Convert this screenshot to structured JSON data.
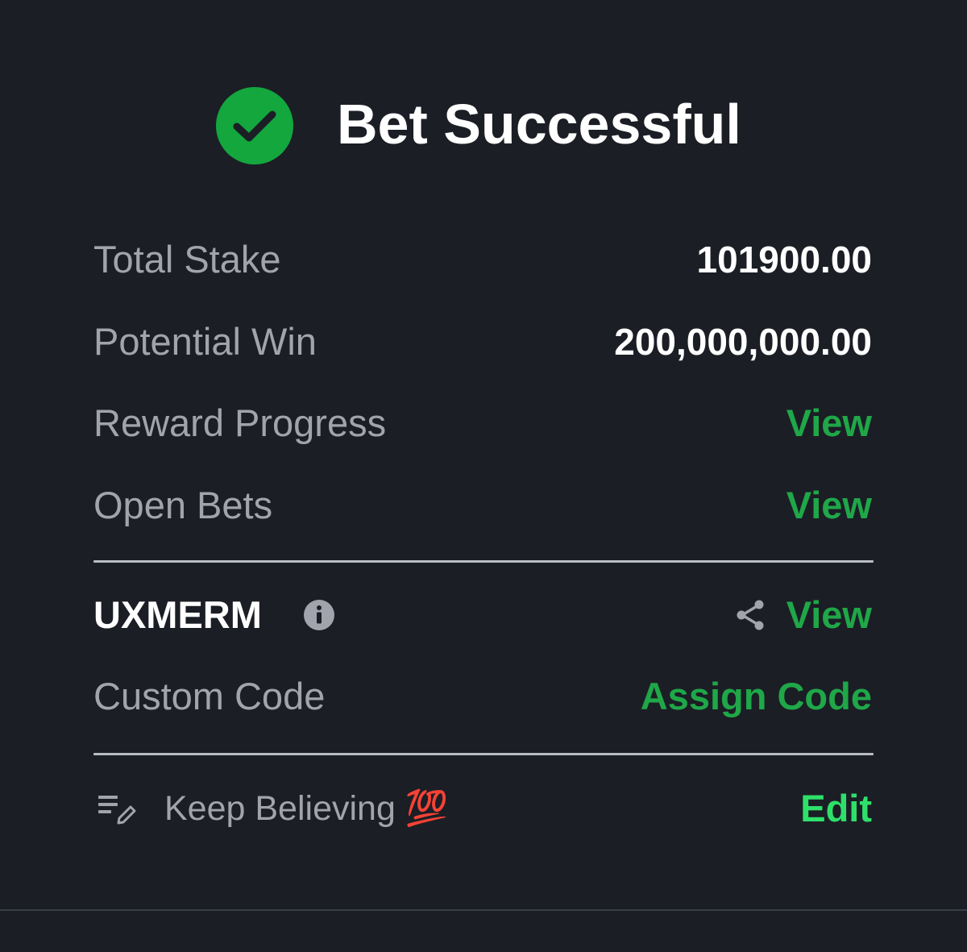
{
  "header": {
    "title": "Bet Successful",
    "icon": "check-circle-icon",
    "icon_color": "#13a73e"
  },
  "summary": {
    "total_stake": {
      "label": "Total Stake",
      "value": "101900.00"
    },
    "potential_win": {
      "label": "Potential Win",
      "value": "200,000,000.00"
    },
    "reward_progress": {
      "label": "Reward Progress",
      "action": "View"
    },
    "open_bets": {
      "label": "Open Bets",
      "action": "View"
    }
  },
  "booking": {
    "code": "UXMERM",
    "info_icon": "info-icon",
    "share_icon": "share-icon",
    "action": "View"
  },
  "custom_code": {
    "label": "Custom Code",
    "action": "Assign Code"
  },
  "note": {
    "icon": "notes-edit-icon",
    "text": "Keep Believing 💯",
    "action": "Edit"
  },
  "colors": {
    "background": "#1b1e25",
    "accent_green": "#1fa748",
    "edit_green": "#2ee06a",
    "label_gray": "#a1a4ad",
    "value_white": "#ffffff"
  }
}
